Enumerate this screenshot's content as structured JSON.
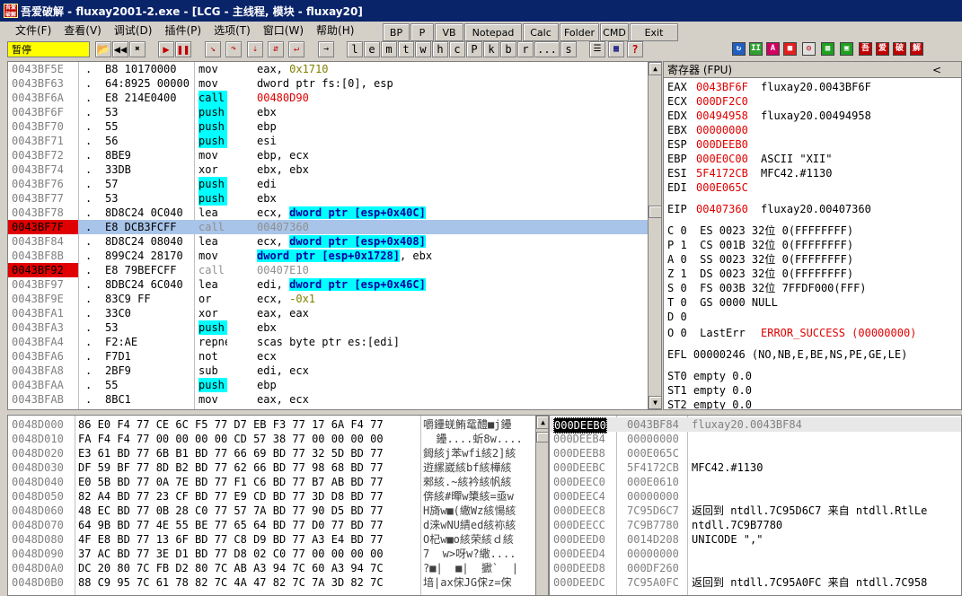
{
  "window": {
    "title": "吾爱破解 - fluxay2001-2.exe - [LCG - 主线程, 模块 - fluxay20]",
    "icon_text": "吾爱破解"
  },
  "menu": [
    "文件(F)",
    "查看(V)",
    "调试(D)",
    "插件(P)",
    "选项(T)",
    "窗口(W)",
    "帮助(H)"
  ],
  "plugin_buttons": [
    "BP",
    "P",
    "VB",
    "Notepad",
    "Calc",
    "Folder",
    "CMD",
    "Exit"
  ],
  "status": "暂停",
  "toolbar_letters": [
    "l",
    "e",
    "m",
    "t",
    "w",
    "h",
    "c",
    "P",
    "k",
    "b",
    "r",
    "...",
    "s"
  ],
  "toolbar_brand": [
    "吾",
    "爱",
    "破",
    "解"
  ],
  "disasm": [
    {
      "addr": "0043BF5E",
      "mark": ".",
      "hex": "B8 10170000",
      "mn": "mov",
      "op": [
        [
          "eax, ",
          ""
        ],
        [
          "0x1710",
          "num"
        ]
      ],
      "style": ""
    },
    {
      "addr": "0043BF63",
      "mark": ".",
      "hex": "64:8925 00000",
      "mn": "mov",
      "op": [
        [
          "dword ptr fs:[0], esp",
          ""
        ]
      ],
      "style": ""
    },
    {
      "addr": "0043BF6A",
      "mark": ".",
      "hex": "E8 214E0400",
      "mn": "call",
      "op": [
        [
          "00480D90",
          "red"
        ]
      ],
      "style": "call"
    },
    {
      "addr": "0043BF6F",
      "mark": ".",
      "hex": "53",
      "mn": "push",
      "op": [
        [
          "ebx",
          ""
        ]
      ],
      "style": "push"
    },
    {
      "addr": "0043BF70",
      "mark": ".",
      "hex": "55",
      "mn": "push",
      "op": [
        [
          "ebp",
          ""
        ]
      ],
      "style": "push"
    },
    {
      "addr": "0043BF71",
      "mark": ".",
      "hex": "56",
      "mn": "push",
      "op": [
        [
          "esi",
          ""
        ]
      ],
      "style": "push"
    },
    {
      "addr": "0043BF72",
      "mark": ".",
      "hex": "8BE9",
      "mn": "mov",
      "op": [
        [
          "ebp, ecx",
          ""
        ]
      ],
      "style": ""
    },
    {
      "addr": "0043BF74",
      "mark": ".",
      "hex": "33DB",
      "mn": "xor",
      "op": [
        [
          "ebx, ebx",
          ""
        ]
      ],
      "style": ""
    },
    {
      "addr": "0043BF76",
      "mark": ".",
      "hex": "57",
      "mn": "push",
      "op": [
        [
          "edi",
          ""
        ]
      ],
      "style": "push"
    },
    {
      "addr": "0043BF77",
      "mark": ".",
      "hex": "53",
      "mn": "push",
      "op": [
        [
          "ebx",
          ""
        ]
      ],
      "style": "push"
    },
    {
      "addr": "0043BF78",
      "mark": ".",
      "hex": "8D8C24 0C040",
      "mn": "lea",
      "op": [
        [
          "ecx, ",
          ""
        ],
        [
          "dword ptr [esp+0x40C]",
          "mem"
        ]
      ],
      "style": ""
    },
    {
      "addr": "0043BF7F",
      "mark": ".",
      "hex": "E8 DCB3FCFF",
      "mn": "call",
      "op": [
        [
          "00407360",
          "gray"
        ]
      ],
      "style": "sel"
    },
    {
      "addr": "0043BF84",
      "mark": ".",
      "hex": "8D8C24 08040",
      "mn": "lea",
      "op": [
        [
          "ecx, ",
          ""
        ],
        [
          "dword ptr [esp+0x408]",
          "mem"
        ]
      ],
      "style": ""
    },
    {
      "addr": "0043BF8B",
      "mark": ".",
      "hex": "899C24 28170",
      "mn": "mov",
      "op": [
        [
          "dword ptr [esp+0x1728]",
          "mem"
        ],
        [
          ", ebx",
          ""
        ]
      ],
      "style": ""
    },
    {
      "addr": "0043BF92",
      "mark": ".",
      "hex": "E8 79BEFCFF",
      "mn": "call",
      "op": [
        [
          "00407E10",
          "gray"
        ]
      ],
      "style": "bp"
    },
    {
      "addr": "0043BF97",
      "mark": ".",
      "hex": "8DBC24 6C040",
      "mn": "lea",
      "op": [
        [
          "edi, ",
          ""
        ],
        [
          "dword ptr [esp+0x46C]",
          "mem"
        ]
      ],
      "style": ""
    },
    {
      "addr": "0043BF9E",
      "mark": ".",
      "hex": "83C9 FF",
      "mn": "or",
      "op": [
        [
          "ecx, ",
          ""
        ],
        [
          "-0x1",
          "num"
        ]
      ],
      "style": ""
    },
    {
      "addr": "0043BFA1",
      "mark": ".",
      "hex": "33C0",
      "mn": "xor",
      "op": [
        [
          "eax, eax",
          ""
        ]
      ],
      "style": ""
    },
    {
      "addr": "0043BFA3",
      "mark": ".",
      "hex": "53",
      "mn": "push",
      "op": [
        [
          "ebx",
          ""
        ]
      ],
      "style": "push"
    },
    {
      "addr": "0043BFA4",
      "mark": ".",
      "hex": "F2:AE",
      "mn": "repne",
      "op": [
        [
          "scas byte ptr es:[edi]",
          ""
        ]
      ],
      "style": ""
    },
    {
      "addr": "0043BFA6",
      "mark": ".",
      "hex": "F7D1",
      "mn": "not",
      "op": [
        [
          "ecx",
          ""
        ]
      ],
      "style": ""
    },
    {
      "addr": "0043BFA8",
      "mark": ".",
      "hex": "2BF9",
      "mn": "sub",
      "op": [
        [
          "edi, ecx",
          ""
        ]
      ],
      "style": ""
    },
    {
      "addr": "0043BFAA",
      "mark": ".",
      "hex": "55",
      "mn": "push",
      "op": [
        [
          "ebp",
          ""
        ]
      ],
      "style": "push"
    },
    {
      "addr": "0043BFAB",
      "mark": ".",
      "hex": "8BC1",
      "mn": "mov",
      "op": [
        [
          "eax, ecx",
          ""
        ]
      ],
      "style": ""
    }
  ],
  "registers_title": "寄存器 (FPU)",
  "registers": [
    {
      "n": "EAX",
      "v": "0043BF6F",
      "c": "fluxay20.0043BF6F"
    },
    {
      "n": "ECX",
      "v": "000DF2C0",
      "c": ""
    },
    {
      "n": "EDX",
      "v": "00494958",
      "c": "fluxay20.00494958"
    },
    {
      "n": "EBX",
      "v": "00000000",
      "c": ""
    },
    {
      "n": "ESP",
      "v": "000DEEB0",
      "c": ""
    },
    {
      "n": "EBP",
      "v": "000E0C00",
      "c": "ASCII \"XII\""
    },
    {
      "n": "ESI",
      "v": "5F4172CB",
      "c": "MFC42.#1130"
    },
    {
      "n": "EDI",
      "v": "000E065C",
      "c": ""
    }
  ],
  "eip": {
    "n": "EIP",
    "v": "00407360",
    "c": "fluxay20.00407360"
  },
  "flags": [
    "C 0  ES 0023 32位 0(FFFFFFFF)",
    "P 1  CS 001B 32位 0(FFFFFFFF)",
    "A 0  SS 0023 32位 0(FFFFFFFF)",
    "Z 1  DS 0023 32位 0(FFFFFFFF)",
    "S 0  FS 003B 32位 7FFDF000(FFF)",
    "T 0  GS 0000 NULL",
    "D 0"
  ],
  "lasterr": {
    "prefix": "O 0  LastErr ",
    "val": "ERROR_SUCCESS (00000000)"
  },
  "efl": "EFL 00000246 (NO,NB,E,BE,NS,PE,GE,LE)",
  "fpu": [
    "ST0 empty 0.0",
    "ST1 empty 0.0",
    "ST2 empty 0.0"
  ],
  "hex_dump": [
    {
      "a": "0048D000",
      "b": "86 E0 F4 77 CE 6C F5 77 D7 EB F3 77 17 6A F4 77",
      "s": "嚼鑸蜣鲔鼋醴■j鑸"
    },
    {
      "a": "0048D010",
      "b": "FA F4 F4 77 00 00 00 00 CD 57 38 77 00 00 00 00",
      "s": "  鑸....蚚8w...."
    },
    {
      "a": "0048D020",
      "b": "E3 61 BD 77 6B B1 BD 77 66 69 BD 77 32 5D BD 77",
      "s": "鉧絯j苯wfi絯2]絯"
    },
    {
      "a": "0048D030",
      "b": "DF 59 BF 77 8D B2 BD 77 62 66 BD 77 98 68 BD 77",
      "s": "逰縲崴絯bf絯樺絯"
    },
    {
      "a": "0048D040",
      "b": "E0 5B BD 77 0A 7E BD 77 F1 C6 BD 77 B7 AB BD 77",
      "s": "郲絯.~絯衿絯帆絯"
    },
    {
      "a": "0048D050",
      "b": "82 A4 BD 77 23 CF BD 77 E9 CD BD 77 3D D8 BD 77",
      "s": "倴絯#暺w橥絯=亟w"
    },
    {
      "a": "0048D060",
      "b": "48 EC BD 77 0B 28 C0 77 57 7A BD 77 90 D5 BD 77",
      "s": "H旖w■(繖Wz絯愓絯"
    },
    {
      "a": "0048D070",
      "b": "64 9B BD 77 4E 55 BE 77 65 64 BD 77 D0 77 BD 77",
      "s": "d涞wNU綪ed絯袮絯"
    },
    {
      "a": "0048D080",
      "b": "4F E8 BD 77 13 6F BD 77 C8 D9 BD 77 A3 E4 BD 77",
      "s": "O杞w■o絯荣絯ｄ絯"
    },
    {
      "a": "0048D090",
      "b": "37 AC BD 77 3E D1 BD 77 D8 02 C0 77 00 00 00 00",
      "s": "7  w>呀w?繖...."
    },
    {
      "a": "0048D0A0",
      "b": "DC 20 80 7C FB D2 80 7C AB A3 94 7C 60 A3 94 7C",
      "s": "?■|  ■|  擨`  |"
    },
    {
      "a": "0048D0B0",
      "b": "88 C9 95 7C 61 78 82 7C 4A 47 82 7C 7A 3D 82 7C",
      "s": "堷|ax俕JG俕z=俕"
    }
  ],
  "stack": [
    {
      "a": "000DEEB0",
      "v": "0043BF84",
      "c": "fluxay20.0043BF84",
      "sel": true
    },
    {
      "a": "000DEEB4",
      "v": "00000000",
      "c": "",
      "sel": false
    },
    {
      "a": "000DEEB8",
      "v": "000E065C",
      "c": "",
      "sel": false
    },
    {
      "a": "000DEEBC",
      "v": "5F4172CB",
      "c": "MFC42.#1130",
      "sel": false
    },
    {
      "a": "000DEEC0",
      "v": "000E0610",
      "c": "",
      "sel": false
    },
    {
      "a": "000DEEC4",
      "v": "00000000",
      "c": "",
      "sel": false
    },
    {
      "a": "000DEEC8",
      "v": "7C95D6C7",
      "c": "返回到 ntdll.7C95D6C7 来自 ntdll.RtlLe",
      "sel": false
    },
    {
      "a": "000DEECC",
      "v": "7C9B7780",
      "c": "ntdll.7C9B7780",
      "sel": false
    },
    {
      "a": "000DEED0",
      "v": "0014D208",
      "c": "UNICODE \",\"",
      "sel": false
    },
    {
      "a": "000DEED4",
      "v": "00000000",
      "c": "",
      "sel": false
    },
    {
      "a": "000DEED8",
      "v": "000DF260",
      "c": "",
      "sel": false
    },
    {
      "a": "000DEEDC",
      "v": "7C95A0FC",
      "c": "返回到 ntdll.7C95A0FC 来自 ntdll.7C958",
      "sel": false
    }
  ]
}
